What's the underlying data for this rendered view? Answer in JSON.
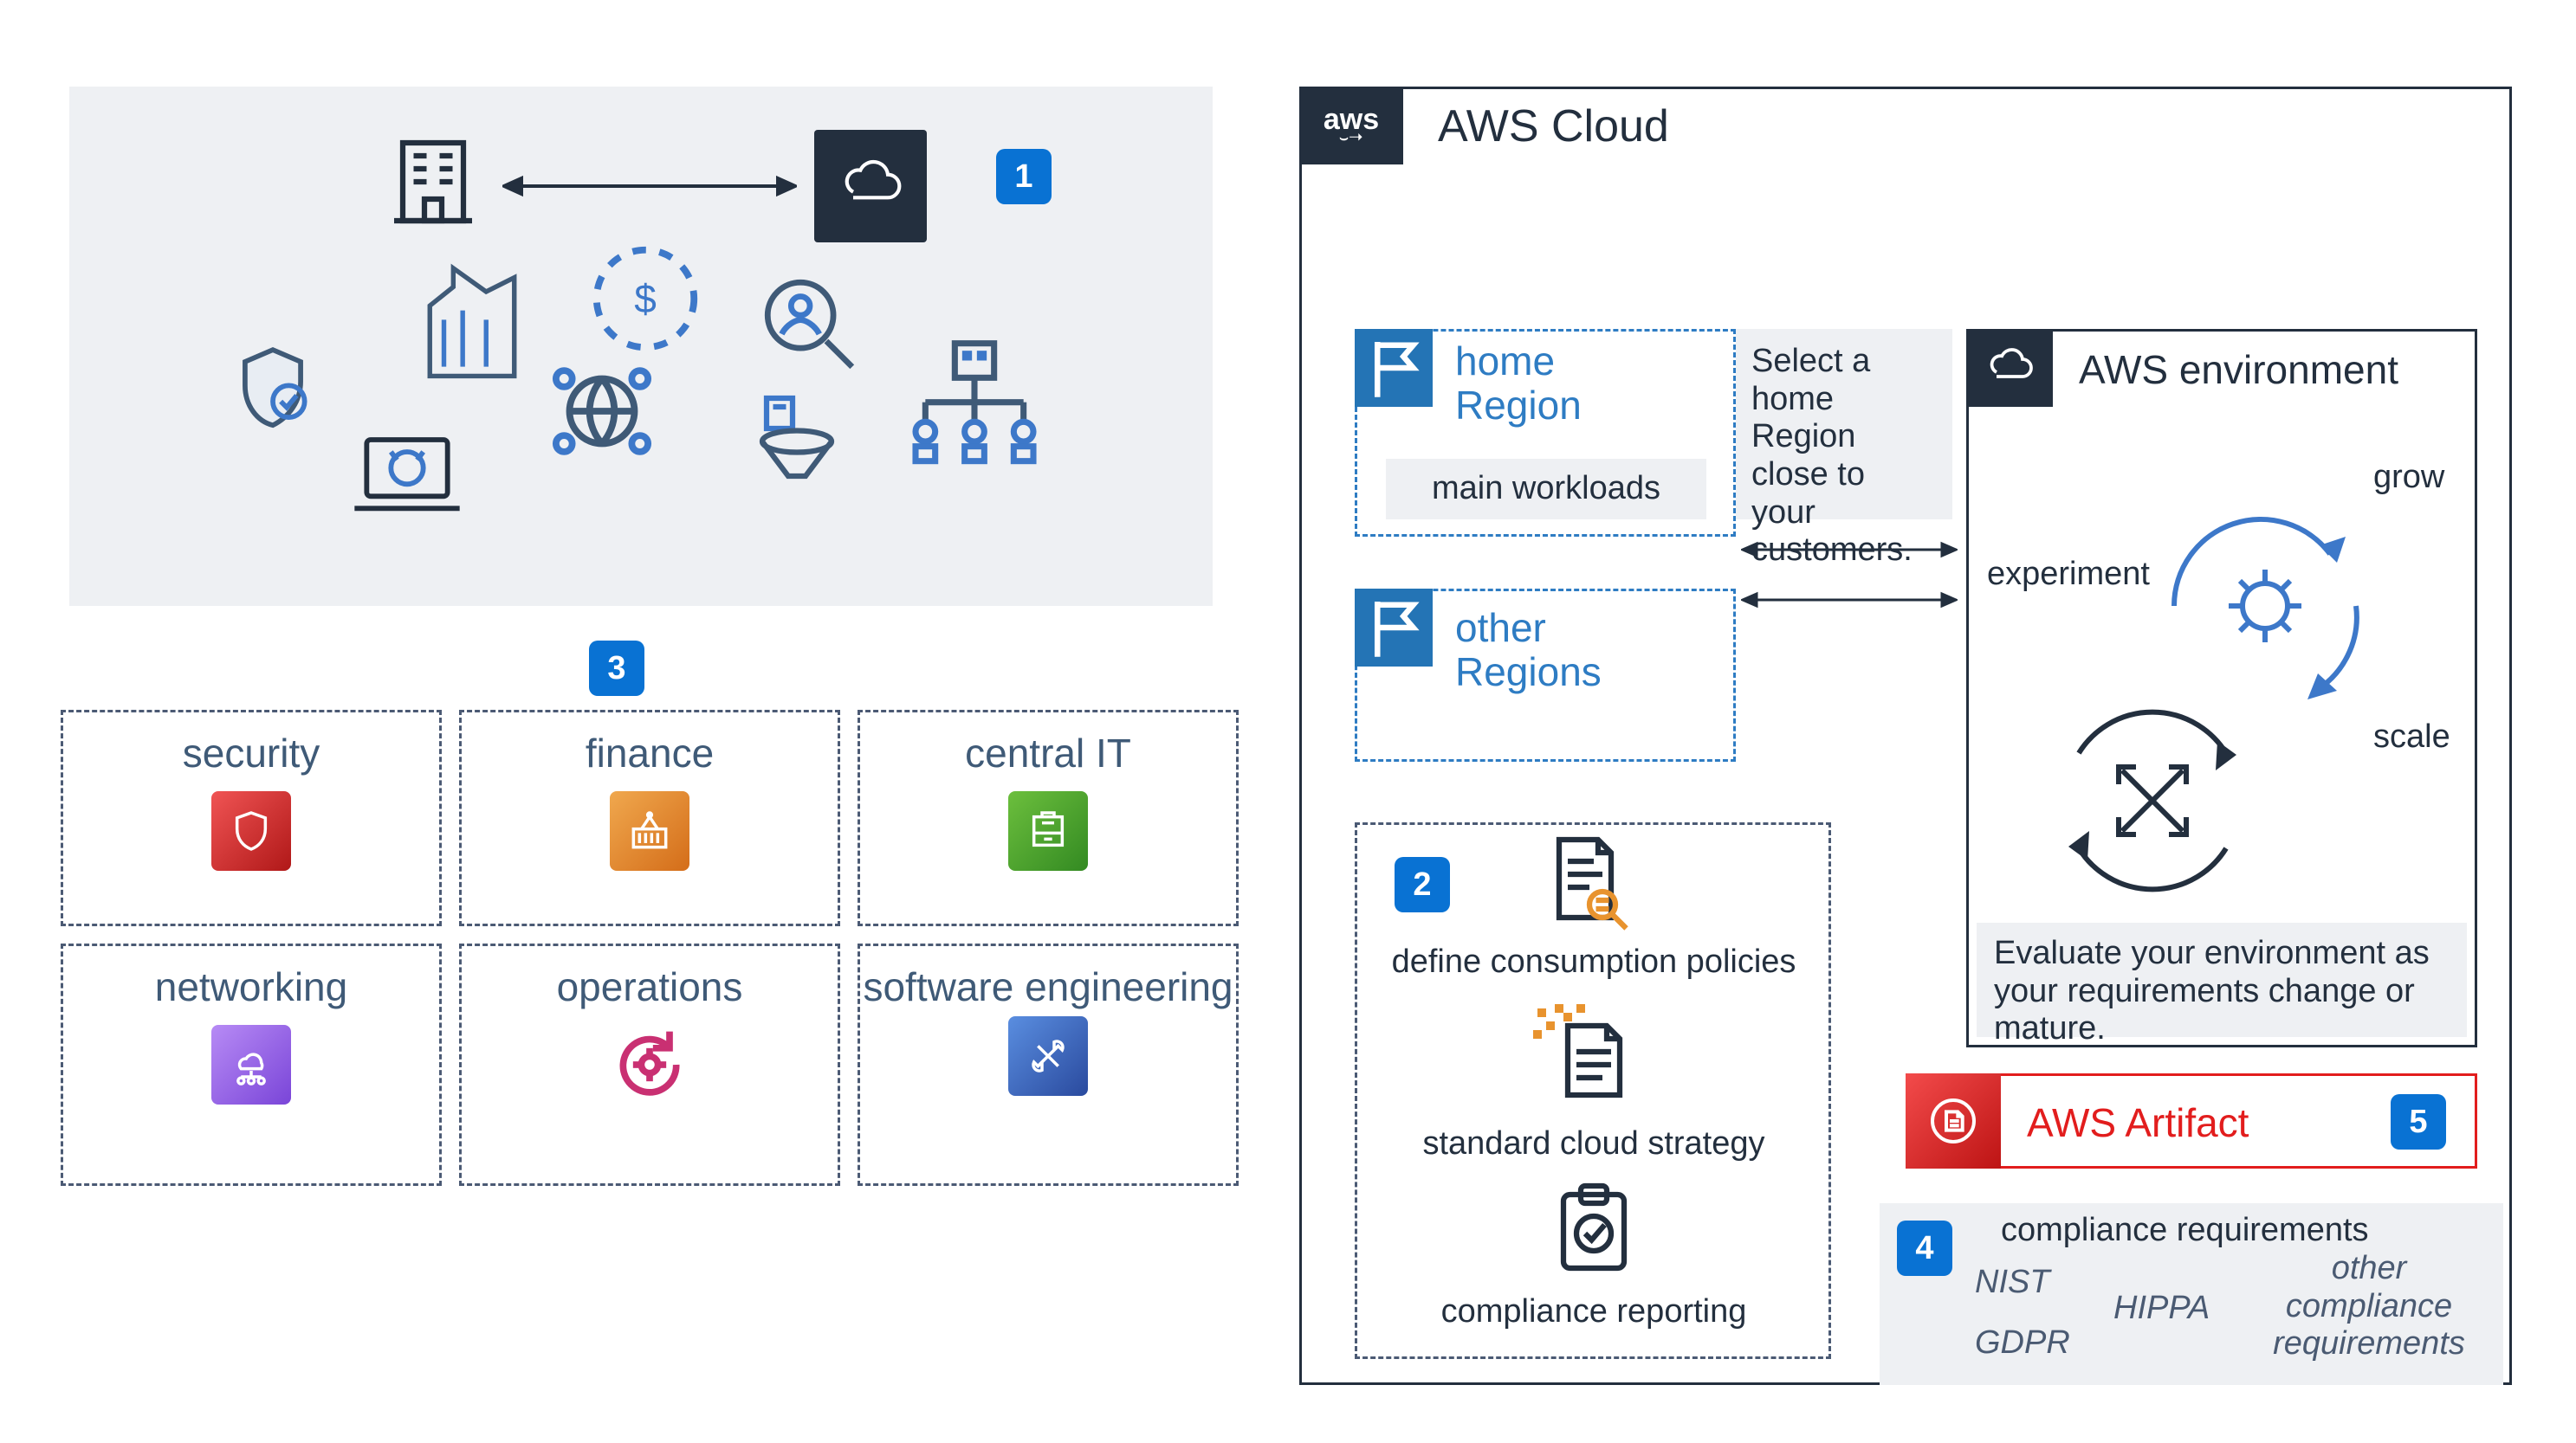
{
  "cloud_title": "AWS Cloud",
  "steps": {
    "1": "1",
    "2": "2",
    "3": "3",
    "4": "4",
    "5": "5"
  },
  "teams": {
    "security": "security",
    "finance": "finance",
    "central_it": "central IT",
    "networking": "networking",
    "operations": "operations",
    "software_eng": "software engineering"
  },
  "regions": {
    "home": "home Region",
    "home_sub": "main workloads",
    "other": "other Regions",
    "hint": "Select a home Region close to your customers."
  },
  "policies": {
    "define": "define consumption policies",
    "strategy": "standard cloud strategy",
    "reporting": "compliance reporting"
  },
  "env": {
    "title": "AWS environment",
    "experiment": "experiment",
    "grow": "grow",
    "scale": "scale",
    "evaluate": "Evaluate your environment as your requirements change or mature."
  },
  "artifact": "AWS Artifact",
  "compliance": {
    "title": "compliance requirements",
    "nist": "NIST",
    "gdpr": "GDPR",
    "hippa": "HIPPA",
    "other": "other compliance requirements"
  }
}
